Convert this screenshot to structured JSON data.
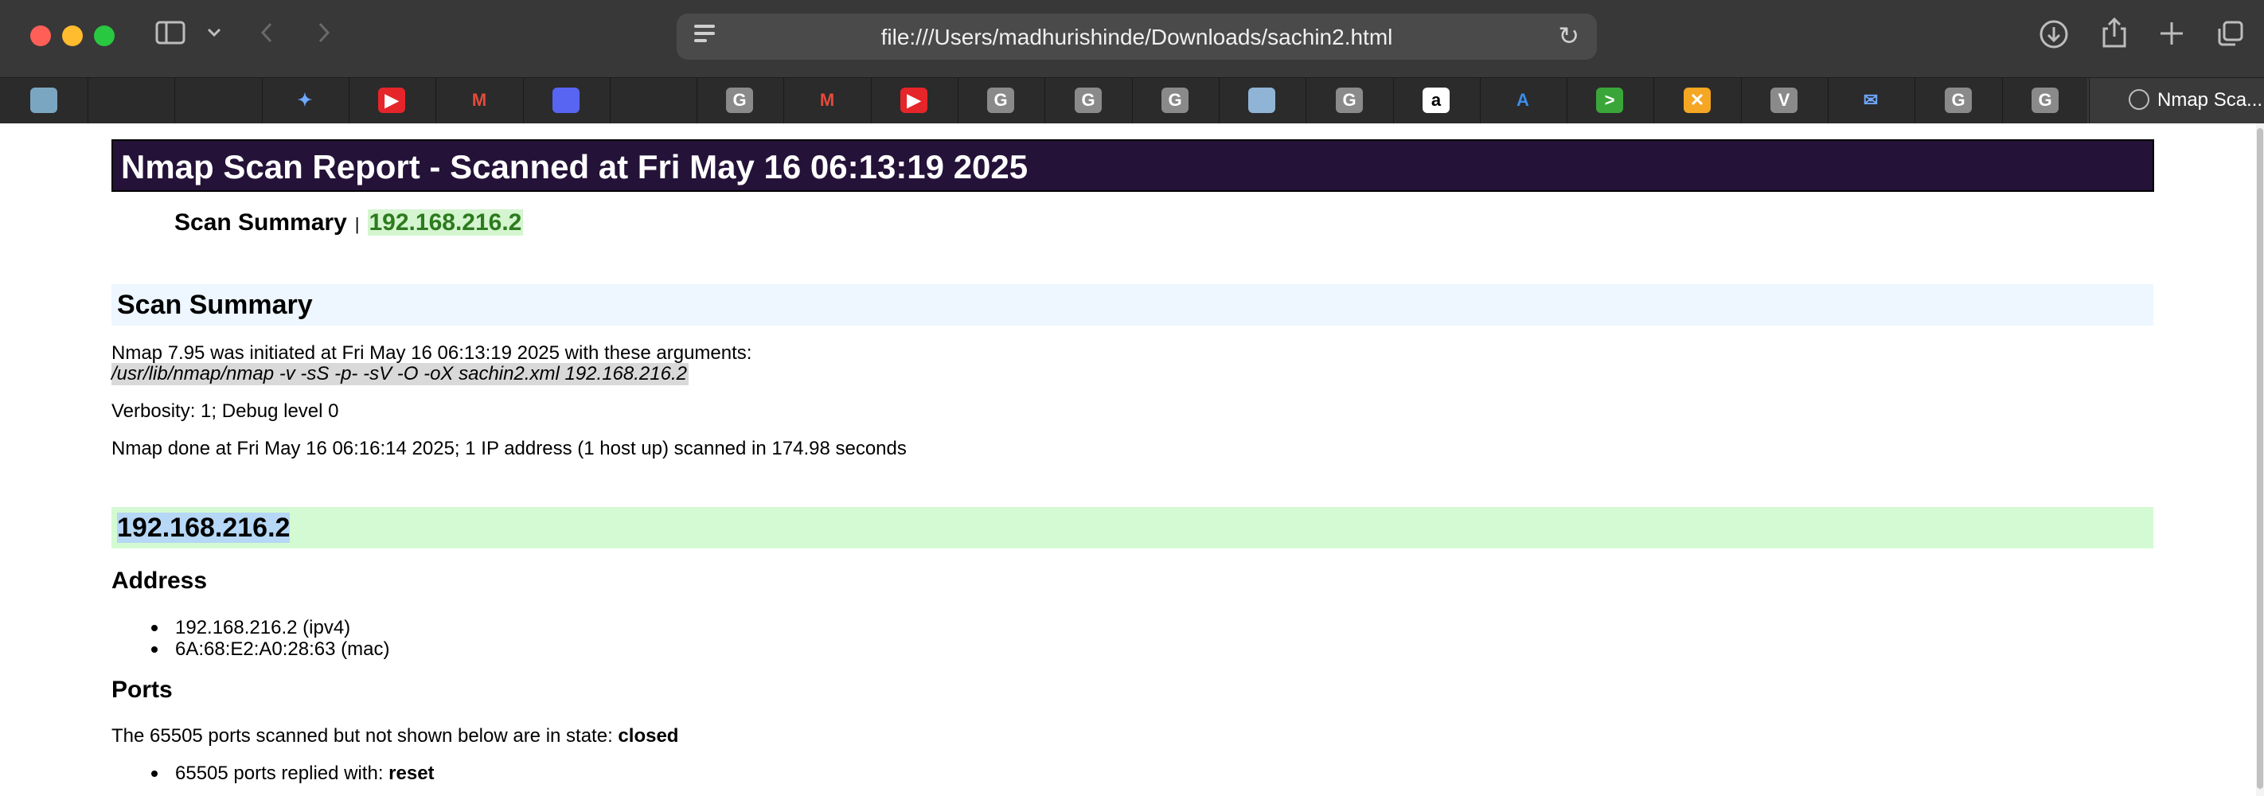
{
  "browser": {
    "url": "file:///Users/madhurishinde/Downloads/sachin2.html",
    "active_tab_title": "Nmap Sca...",
    "favorites": [
      {
        "icon": "nocodb-icon",
        "glyph": "",
        "color": "#7aa6c2"
      },
      {
        "icon": "cloud-icon",
        "glyph": "",
        "color": "#2b2b2b"
      },
      {
        "icon": "openai-icon",
        "glyph": "",
        "color": "#2b2b2b"
      },
      {
        "icon": "gemini-icon",
        "glyph": "✦",
        "color": "#2b2b2b"
      },
      {
        "icon": "youtube-icon",
        "glyph": "▶",
        "color": "#e5252a"
      },
      {
        "icon": "gmail-icon",
        "glyph": "M",
        "color": "#2b2b2b"
      },
      {
        "icon": "discord-icon",
        "glyph": "",
        "color": "#5865f2"
      },
      {
        "icon": "github-icon",
        "glyph": "",
        "color": "#2b2b2b"
      },
      {
        "icon": "g-letter-icon",
        "glyph": "G",
        "color": "#8a8a8a"
      },
      {
        "icon": "gmail-icon",
        "glyph": "M",
        "color": "#2b2b2b"
      },
      {
        "icon": "youtube-icon",
        "glyph": "▶",
        "color": "#e5252a"
      },
      {
        "icon": "g-letter-icon",
        "glyph": "G",
        "color": "#8a8a8a"
      },
      {
        "icon": "g-letter-icon",
        "glyph": "G",
        "color": "#8a8a8a"
      },
      {
        "icon": "g-letter-icon",
        "glyph": "G",
        "color": "#8a8a8a"
      },
      {
        "icon": "app-icon",
        "glyph": "",
        "color": "#8fb4d6"
      },
      {
        "icon": "g-letter-icon",
        "glyph": "G",
        "color": "#8a8a8a"
      },
      {
        "icon": "amazon-icon",
        "glyph": "a",
        "color": "#ffffff"
      },
      {
        "icon": "azure-icon",
        "glyph": "A",
        "color": "#2b2b2b"
      },
      {
        "icon": "arrow-icon",
        "glyph": ">",
        "color": "#3aa63a"
      },
      {
        "icon": "x-circle-icon",
        "glyph": "✕",
        "color": "#f5a623"
      },
      {
        "icon": "v-letter-icon",
        "glyph": "V",
        "color": "#8a8a8a"
      },
      {
        "icon": "mail-icon",
        "glyph": "✉",
        "color": "#2b2b2b"
      },
      {
        "icon": "g-letter-icon",
        "glyph": "G",
        "color": "#8a8a8a"
      },
      {
        "icon": "g-letter-icon",
        "glyph": "G",
        "color": "#8a8a8a"
      }
    ]
  },
  "report": {
    "title": "Nmap Scan Report - Scanned at Fri May 16 06:13:19 2025",
    "summary_label": "Scan Summary",
    "summary_sep": "|",
    "summary_ip": "192.168.216.2",
    "section_summary": "Scan Summary",
    "initiated": "Nmap 7.95 was initiated at Fri May 16 06:13:19 2025 with these arguments:",
    "arguments": "/usr/lib/nmap/nmap -v -sS -p- -sV -O -oX sachin2.xml 192.168.216.2",
    "verbosity": "Verbosity: 1; Debug level 0",
    "done": "Nmap done at Fri May 16 06:16:14 2025; 1 IP address (1 host up) scanned in 174.98 seconds",
    "host_heading": "192.168.216.2",
    "address_heading": "Address",
    "addresses": [
      "192.168.216.2 (ipv4)",
      "6A:68:E2:A0:28:63 (mac)"
    ],
    "ports_heading": "Ports",
    "ports_text": "The 65505 ports scanned but not shown below are in state:",
    "ports_state": "closed",
    "ports_reply_text": "65505 ports replied with:",
    "ports_reply_value": "reset"
  }
}
